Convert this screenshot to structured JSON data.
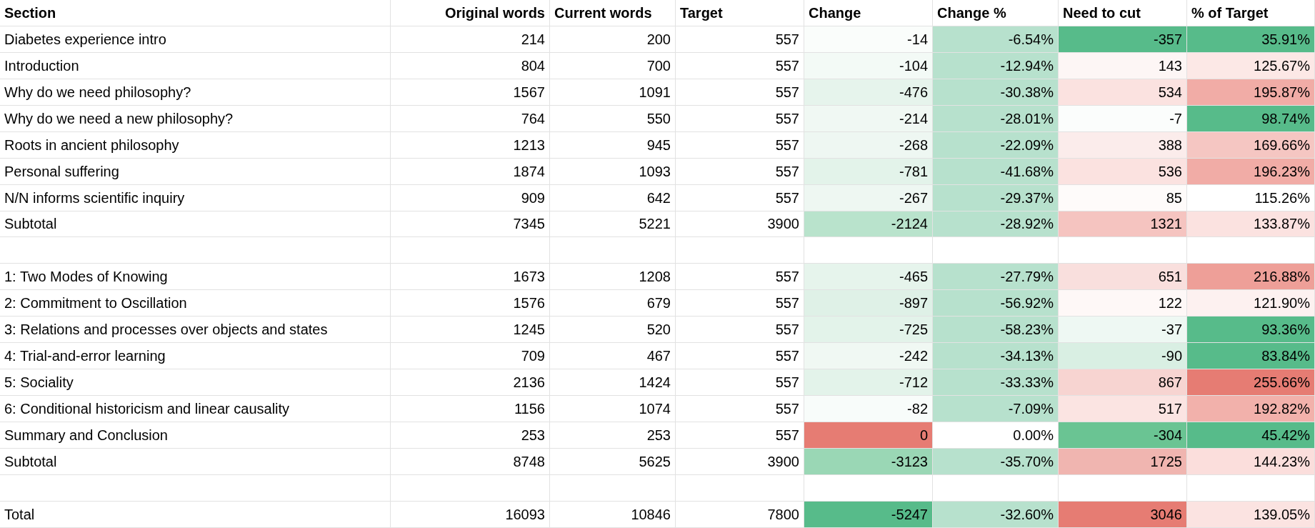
{
  "table": {
    "columns": [
      "Section",
      "Original words",
      "Current words",
      "Target",
      "Change",
      "Change %",
      "Need to cut",
      "% of Target"
    ],
    "rows": [
      {
        "kind": "data",
        "cells": [
          {
            "text": "Diabetes experience intro"
          },
          {
            "text": "214"
          },
          {
            "text": "200"
          },
          {
            "text": "557"
          },
          {
            "text": "-14",
            "color": "#fafdfb"
          },
          {
            "text": "-6.54%",
            "color": "#b7e1cd"
          },
          {
            "text": "-357",
            "color": "#57bb8a"
          },
          {
            "text": "35.91%",
            "color": "#57bb8a"
          }
        ]
      },
      {
        "kind": "data",
        "cells": [
          {
            "text": "Introduction"
          },
          {
            "text": "804"
          },
          {
            "text": "700"
          },
          {
            "text": "557"
          },
          {
            "text": "-104",
            "color": "#f3faf6"
          },
          {
            "text": "-12.94%",
            "color": "#b7e1cd"
          },
          {
            "text": "143",
            "color": "#fdf6f5"
          },
          {
            "text": "125.67%",
            "color": "#fce8e6"
          }
        ]
      },
      {
        "kind": "data",
        "cells": [
          {
            "text": "Why do we need philosophy?"
          },
          {
            "text": "1567"
          },
          {
            "text": "1091"
          },
          {
            "text": "557"
          },
          {
            "text": "-476",
            "color": "#e6f4ec"
          },
          {
            "text": "-30.38%",
            "color": "#b7e1cd"
          },
          {
            "text": "534",
            "color": "#fbe2e0"
          },
          {
            "text": "195.87%",
            "color": "#f1aca6"
          }
        ]
      },
      {
        "kind": "data",
        "cells": [
          {
            "text": "Why do we need a new philosophy?"
          },
          {
            "text": "764"
          },
          {
            "text": "550"
          },
          {
            "text": "557"
          },
          {
            "text": "-214",
            "color": "#f0f8f3"
          },
          {
            "text": "-28.01%",
            "color": "#b7e1cd"
          },
          {
            "text": "-7",
            "color": "#fbfdfc"
          },
          {
            "text": "98.74%",
            "color": "#57bb8a"
          }
        ]
      },
      {
        "kind": "data",
        "cells": [
          {
            "text": "Roots in ancient philosophy"
          },
          {
            "text": "1213"
          },
          {
            "text": "945"
          },
          {
            "text": "557"
          },
          {
            "text": "-268",
            "color": "#eef7f2"
          },
          {
            "text": "-22.09%",
            "color": "#b7e1cd"
          },
          {
            "text": "388",
            "color": "#fbeceb"
          },
          {
            "text": "169.66%",
            "color": "#f5c6c2"
          }
        ]
      },
      {
        "kind": "data",
        "cells": [
          {
            "text": "Personal suffering"
          },
          {
            "text": "1874"
          },
          {
            "text": "1093"
          },
          {
            "text": "557"
          },
          {
            "text": "-781",
            "color": "#e3f3ea"
          },
          {
            "text": "-41.68%",
            "color": "#b7e1cd"
          },
          {
            "text": "536",
            "color": "#fbe2e0"
          },
          {
            "text": "196.23%",
            "color": "#f1aca6"
          }
        ]
      },
      {
        "kind": "data",
        "cells": [
          {
            "text": "N/N informs scientific inquiry"
          },
          {
            "text": "909"
          },
          {
            "text": "642"
          },
          {
            "text": "557"
          },
          {
            "text": "-267",
            "color": "#eef7f2"
          },
          {
            "text": "-29.37%",
            "color": "#b7e1cd"
          },
          {
            "text": "85",
            "color": "#fefbfa"
          },
          {
            "text": "115.26%"
          }
        ]
      },
      {
        "kind": "data",
        "cells": [
          {
            "text": "Subtotal"
          },
          {
            "text": "7345"
          },
          {
            "text": "5221"
          },
          {
            "text": "3900"
          },
          {
            "text": "-2124",
            "color": "#b9e3cc"
          },
          {
            "text": "-28.92%",
            "color": "#b7e1cd"
          },
          {
            "text": "1321",
            "color": "#f5c4c0"
          },
          {
            "text": "133.87%",
            "color": "#fbe2e0"
          }
        ]
      },
      {
        "kind": "blank"
      },
      {
        "kind": "data",
        "cells": [
          {
            "text": "1: Two Modes of Knowing"
          },
          {
            "text": "1673"
          },
          {
            "text": "1208"
          },
          {
            "text": "557"
          },
          {
            "text": "-465",
            "color": "#e6f4ec"
          },
          {
            "text": "-27.79%",
            "color": "#b7e1cd"
          },
          {
            "text": "651",
            "color": "#f9dfdd"
          },
          {
            "text": "216.88%",
            "color": "#ee9f98"
          }
        ]
      },
      {
        "kind": "data",
        "cells": [
          {
            "text": "2: Commitment to Oscillation"
          },
          {
            "text": "1576"
          },
          {
            "text": "679"
          },
          {
            "text": "557"
          },
          {
            "text": "-897",
            "color": "#dff1e7"
          },
          {
            "text": "-56.92%",
            "color": "#b7e1cd"
          },
          {
            "text": "122",
            "color": "#fef8f7"
          },
          {
            "text": "121.90%",
            "color": "#fdf1f0"
          }
        ]
      },
      {
        "kind": "data",
        "cells": [
          {
            "text": "3: Relations and processes over objects and states"
          },
          {
            "text": "1245"
          },
          {
            "text": "520"
          },
          {
            "text": "557"
          },
          {
            "text": "-725",
            "color": "#e3f3ea"
          },
          {
            "text": "-58.23%",
            "color": "#b7e1cd"
          },
          {
            "text": "-37",
            "color": "#eef8f3"
          },
          {
            "text": "93.36%",
            "color": "#57bb8a"
          }
        ]
      },
      {
        "kind": "data",
        "cells": [
          {
            "text": "4: Trial-and-error learning"
          },
          {
            "text": "709"
          },
          {
            "text": "467"
          },
          {
            "text": "557"
          },
          {
            "text": "-242",
            "color": "#f0f8f3"
          },
          {
            "text": "-34.13%",
            "color": "#b7e1cd"
          },
          {
            "text": "-90",
            "color": "#d9efe3"
          },
          {
            "text": "83.84%",
            "color": "#57bb8a"
          }
        ]
      },
      {
        "kind": "data",
        "cells": [
          {
            "text": "5: Sociality"
          },
          {
            "text": "2136"
          },
          {
            "text": "1424"
          },
          {
            "text": "557"
          },
          {
            "text": "-712",
            "color": "#e3f3ea"
          },
          {
            "text": "-33.33%",
            "color": "#b7e1cd"
          },
          {
            "text": "867",
            "color": "#f7d4d1"
          },
          {
            "text": "255.66%",
            "color": "#e67c73"
          }
        ]
      },
      {
        "kind": "data",
        "cells": [
          {
            "text": "6: Conditional historicism and linear causality"
          },
          {
            "text": "1156"
          },
          {
            "text": "1074"
          },
          {
            "text": "557"
          },
          {
            "text": "-82",
            "color": "#f8fcfa"
          },
          {
            "text": "-7.09%",
            "color": "#b7e1cd"
          },
          {
            "text": "517",
            "color": "#fbe4e2"
          },
          {
            "text": "192.82%",
            "color": "#f2b1ab"
          }
        ]
      },
      {
        "kind": "data",
        "cells": [
          {
            "text": "Summary and Conclusion"
          },
          {
            "text": "253"
          },
          {
            "text": "253"
          },
          {
            "text": "557"
          },
          {
            "text": "0",
            "color": "#e67c73"
          },
          {
            "text": "0.00%"
          },
          {
            "text": "-304",
            "color": "#6ac493"
          },
          {
            "text": "45.42%",
            "color": "#57bb8a"
          }
        ]
      },
      {
        "kind": "data",
        "cells": [
          {
            "text": "Subtotal"
          },
          {
            "text": "8748"
          },
          {
            "text": "5625"
          },
          {
            "text": "3900"
          },
          {
            "text": "-3123",
            "color": "#9ad7b5"
          },
          {
            "text": "-35.70%",
            "color": "#b7e1cd"
          },
          {
            "text": "1725",
            "color": "#f0b5b0"
          },
          {
            "text": "144.23%",
            "color": "#fbdedc"
          }
        ]
      },
      {
        "kind": "blank"
      },
      {
        "kind": "data",
        "cells": [
          {
            "text": "Total"
          },
          {
            "text": "16093"
          },
          {
            "text": "10846"
          },
          {
            "text": "7800"
          },
          {
            "text": "-5247",
            "color": "#57bb8a"
          },
          {
            "text": "-32.60%",
            "color": "#b7e1cd"
          },
          {
            "text": "3046",
            "color": "#e67c73"
          },
          {
            "text": "139.05%",
            "color": "#fbe3e1"
          }
        ]
      }
    ]
  }
}
